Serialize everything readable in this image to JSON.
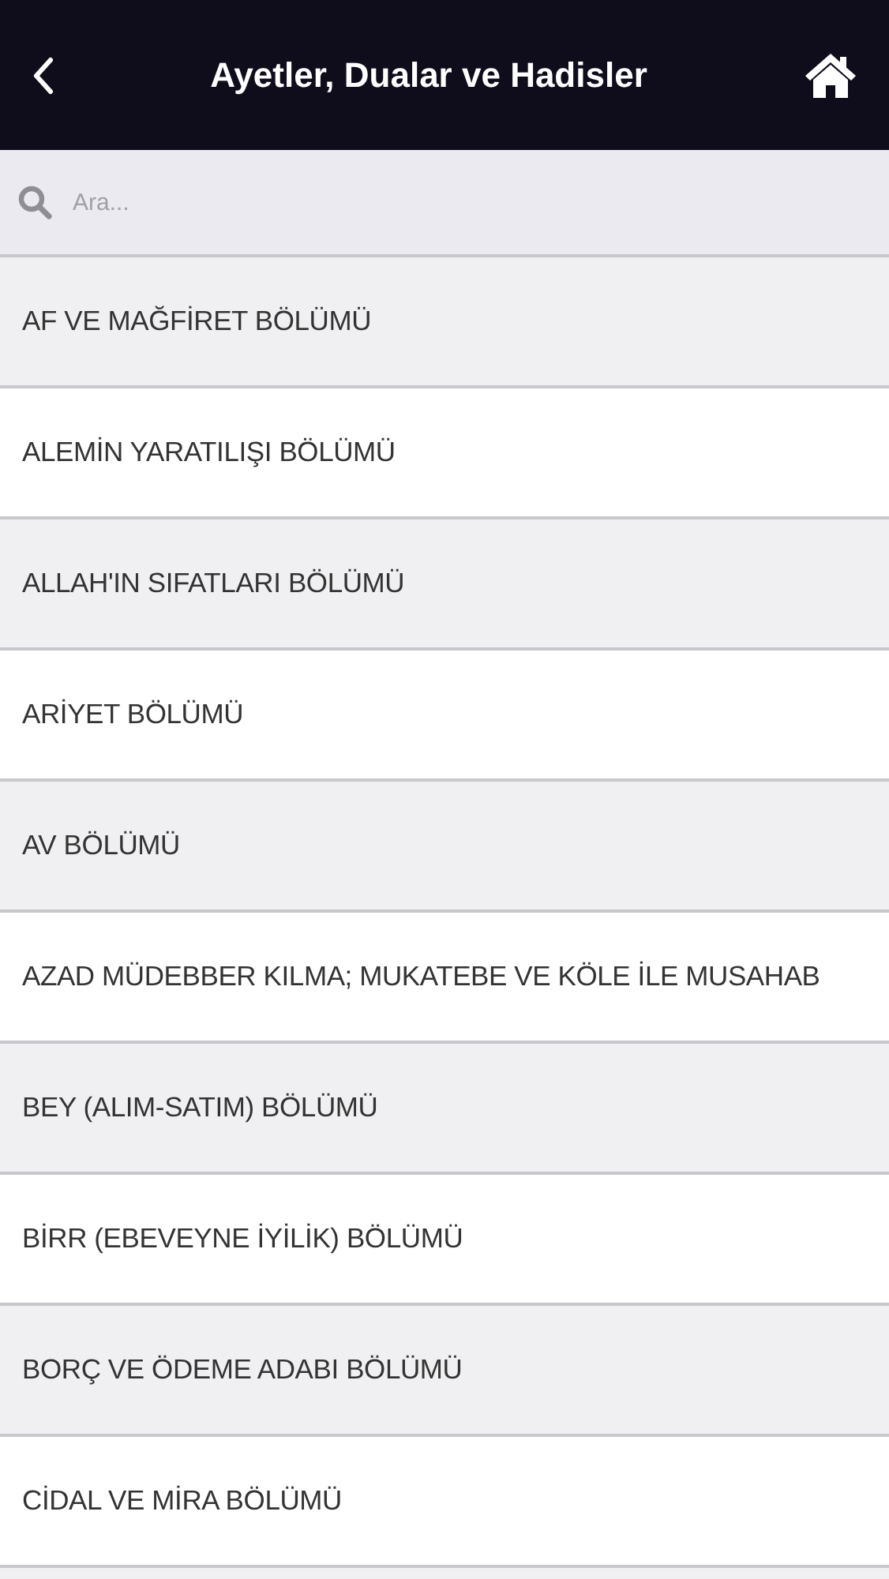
{
  "header": {
    "title": "Ayetler, Dualar ve Hadisler"
  },
  "search": {
    "placeholder": "Ara..."
  },
  "sections": [
    {
      "label": "AF VE MAĞFİRET BÖLÜMÜ"
    },
    {
      "label": "ALEMİN YARATILIŞI BÖLÜMÜ"
    },
    {
      "label": "ALLAH'IN SIFATLARI BÖLÜMÜ"
    },
    {
      "label": "ARİYET BÖLÜMÜ"
    },
    {
      "label": "AV BÖLÜMÜ"
    },
    {
      "label": "AZAD MÜDEBBER KILMA; MUKATEBE VE KÖLE İLE MUSAHAB"
    },
    {
      "label": "BEY (ALIM-SATIM) BÖLÜMÜ"
    },
    {
      "label": "BİRR (EBEVEYNE İYİLİK) BÖLÜMÜ"
    },
    {
      "label": "BORÇ VE ÖDEME ADABI BÖLÜMÜ"
    },
    {
      "label": "CİDAL VE MİRA BÖLÜMÜ"
    }
  ]
}
